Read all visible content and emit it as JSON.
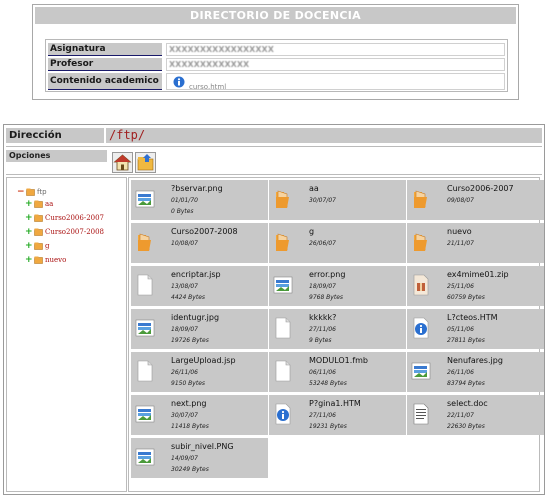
{
  "directory": {
    "title": "DIRECTORIO DE DOCENCIA",
    "asignatura_label": "Asignatura",
    "asignatura_value": "XXXXXXXXXXXXXXXXX",
    "profesor_label": "Profesor",
    "profesor_value": "XXXXXXXXXXXXX",
    "contenido_label": "Contenido academico",
    "contenido_link": "curso.html"
  },
  "browser": {
    "direccion_label": "Dirección",
    "path": "/ftp/",
    "opciones_label": "Opciones",
    "tree": [
      {
        "name": "ftp",
        "root": true
      },
      {
        "name": "aa"
      },
      {
        "name": "Curso2006-2007"
      },
      {
        "name": "Curso2007-2008"
      },
      {
        "name": "g"
      },
      {
        "name": "nuevo"
      }
    ],
    "files": [
      {
        "name": "?bservar.png",
        "date": "01/01/70",
        "size": "0 Bytes",
        "icon": "image-icon"
      },
      {
        "name": "aa",
        "date": "30/07/07",
        "size": "",
        "icon": "folder-icon"
      },
      {
        "name": "Curso2006-2007",
        "date": "09/08/07",
        "size": "",
        "icon": "folder-icon"
      },
      {
        "name": "Curso2007-2008",
        "date": "10/08/07",
        "size": "",
        "icon": "folder-icon"
      },
      {
        "name": "g",
        "date": "26/06/07",
        "size": "",
        "icon": "folder-icon"
      },
      {
        "name": "nuevo",
        "date": "21/11/07",
        "size": "",
        "icon": "folder-icon"
      },
      {
        "name": "encriptar.jsp",
        "date": "13/08/07",
        "size": "4424 Bytes",
        "icon": "document-icon"
      },
      {
        "name": "error.png",
        "date": "18/09/07",
        "size": "9768 Bytes",
        "icon": "image-icon"
      },
      {
        "name": "ex4mime01.zip",
        "date": "25/11/06",
        "size": "60759 Bytes",
        "icon": "archive-icon"
      },
      {
        "name": "identugr.jpg",
        "date": "18/09/07",
        "size": "19726 Bytes",
        "icon": "image-icon"
      },
      {
        "name": "kkkkk?",
        "date": "27/11/06",
        "size": "9 Bytes",
        "icon": "document-icon"
      },
      {
        "name": "L?cteos.HTM",
        "date": "05/11/06",
        "size": "27811 Bytes",
        "icon": "info-icon"
      },
      {
        "name": "LargeUpload.jsp",
        "date": "26/11/06",
        "size": "9150 Bytes",
        "icon": "document-icon"
      },
      {
        "name": "MODULO1.fmb",
        "date": "06/11/06",
        "size": "53248 Bytes",
        "icon": "document-icon"
      },
      {
        "name": "Nenufares.jpg",
        "date": "26/11/06",
        "size": "83794 Bytes",
        "icon": "image-icon"
      },
      {
        "name": "next.png",
        "date": "30/07/07",
        "size": "11418 Bytes",
        "icon": "image-icon"
      },
      {
        "name": "P?gina1.HTM",
        "date": "27/11/06",
        "size": "19231 Bytes",
        "icon": "info-icon"
      },
      {
        "name": "select.doc",
        "date": "22/11/07",
        "size": "22630 Bytes",
        "icon": "text-document-icon"
      },
      {
        "name": "subir_nivel.PNG",
        "date": "14/09/07",
        "size": "30249 Bytes",
        "icon": "image-icon"
      }
    ]
  },
  "colors": {
    "panel": "#c8c8c8",
    "path": "#a02020",
    "tree_name": "#aa1111"
  }
}
